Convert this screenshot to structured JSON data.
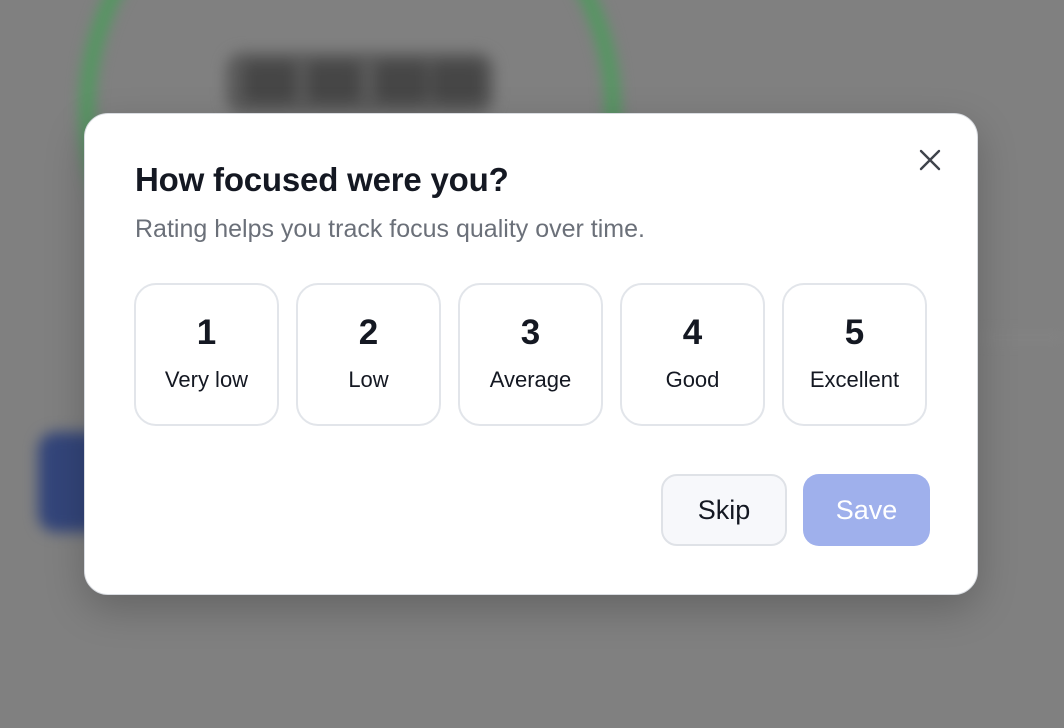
{
  "dialog": {
    "title": "How focused were you?",
    "subtitle": "Rating helps you track focus quality over time.",
    "close_icon": "close-icon",
    "rating_options": [
      {
        "number": "1",
        "label": "Very low"
      },
      {
        "number": "2",
        "label": "Low"
      },
      {
        "number": "3",
        "label": "Average"
      },
      {
        "number": "4",
        "label": "Good"
      },
      {
        "number": "5",
        "label": "Excellent"
      }
    ],
    "skip_label": "Skip",
    "save_label": "Save"
  },
  "colors": {
    "save_button_disabled": "#9fb0ec",
    "overlay": "#808080",
    "background_ring": "#4d9a5c",
    "background_button": "#33457a"
  }
}
